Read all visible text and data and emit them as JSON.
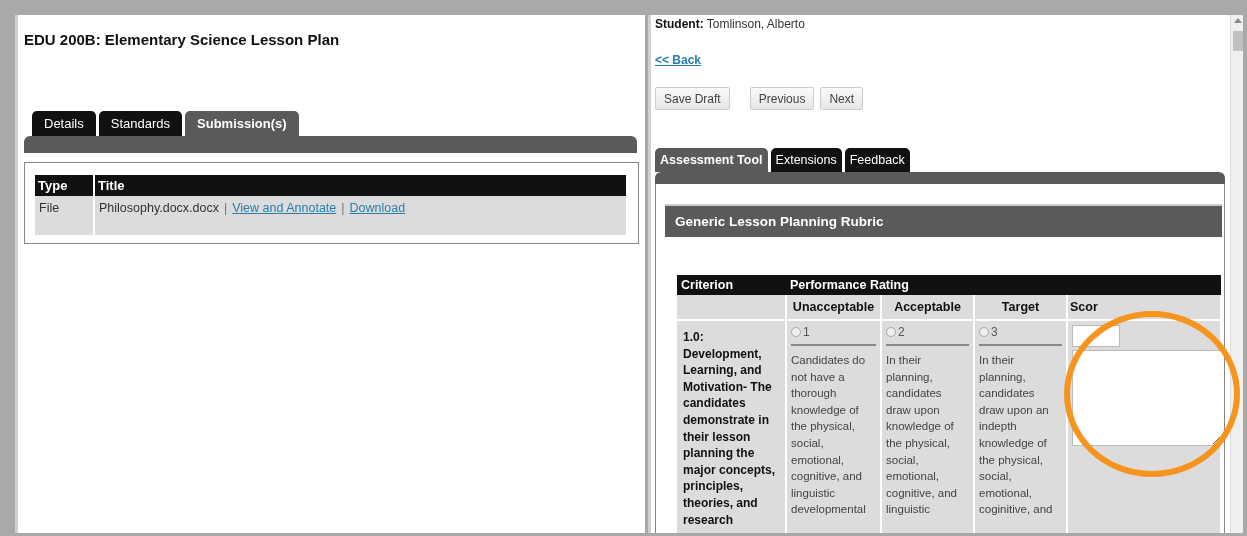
{
  "course_title": "EDU 200B: Elementary Science Lesson Plan",
  "left_tabs": [
    {
      "label": "Details",
      "selected": false
    },
    {
      "label": "Standards",
      "selected": false
    },
    {
      "label": "Submission(s)",
      "selected": true
    }
  ],
  "submissions": {
    "columns": [
      "Type",
      "Title"
    ],
    "rows": [
      {
        "type": "File",
        "title": "Philosophy.docx.docx",
        "links": [
          {
            "separator": "|",
            "label": "View and Annotate"
          },
          {
            "separator": "|",
            "label": "Download"
          }
        ]
      }
    ]
  },
  "student": {
    "label": "Student:",
    "name": "Tomlinson, Alberto"
  },
  "back_link": "<< Back",
  "buttons": [
    "Save Draft",
    "Previous",
    "Next"
  ],
  "right_tabs": [
    {
      "label": "Assessment Tool",
      "selected": true
    },
    {
      "label": "Extensions",
      "selected": false
    },
    {
      "label": "Feedback",
      "selected": false
    }
  ],
  "rubric": {
    "title": "Generic Lesson Planning Rubric",
    "criterion_heading": "Criterion",
    "rating_heading": "Performance Rating",
    "levels": [
      "Unacceptable",
      "Acceptable",
      "Target"
    ],
    "score_heading": "Scor",
    "criteria": [
      {
        "text": "1.0: Development, Learning, and Motivation- The candidates demonstrate in their lesson planning the major concepts, principles, theories, and research",
        "ratings": [
          {
            "value": "1",
            "selected": false,
            "description": "Candidates do not have a thorough knowledge of the physical, social, emotional, cognitive, and linguistic developmental"
          },
          {
            "value": "2",
            "selected": false,
            "description": "In their planning, candidates draw upon knowledge of the physical, social, emotional, cognitive, and linguistic"
          },
          {
            "value": "3",
            "selected": false,
            "description": "In their planning, candidates draw upon an indepth knowledge of the physical, social, emotional, coginitive, and"
          }
        ]
      }
    ]
  }
}
